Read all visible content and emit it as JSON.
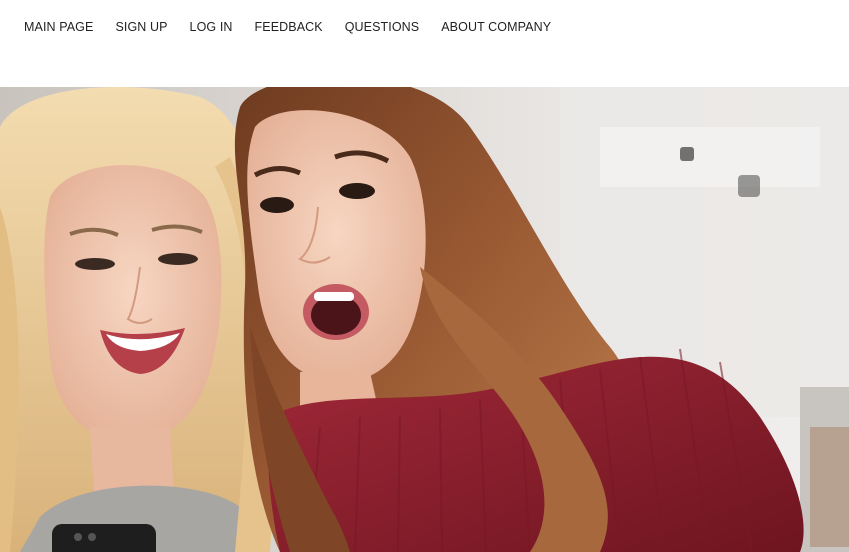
{
  "nav": {
    "items": [
      {
        "label": "MAIN PAGE"
      },
      {
        "label": "SIGN UP"
      },
      {
        "label": "LOG IN"
      },
      {
        "label": "FEEDBACK"
      },
      {
        "label": "QUESTIONS"
      },
      {
        "label": "ABOUT COMPANY"
      }
    ]
  },
  "hero": {
    "image_subject": "two-women-looking-at-phone-photo",
    "colors": {
      "background_wall": "#e9e7e5",
      "blonde_hair": "#e8c58e",
      "brunette_hair": "#8a4f2c",
      "skin": "#f0c7b0",
      "red_sweater": "#8e1f2c",
      "grey_sweater": "#a8a6a3",
      "phone": "#1e1e1e"
    }
  }
}
